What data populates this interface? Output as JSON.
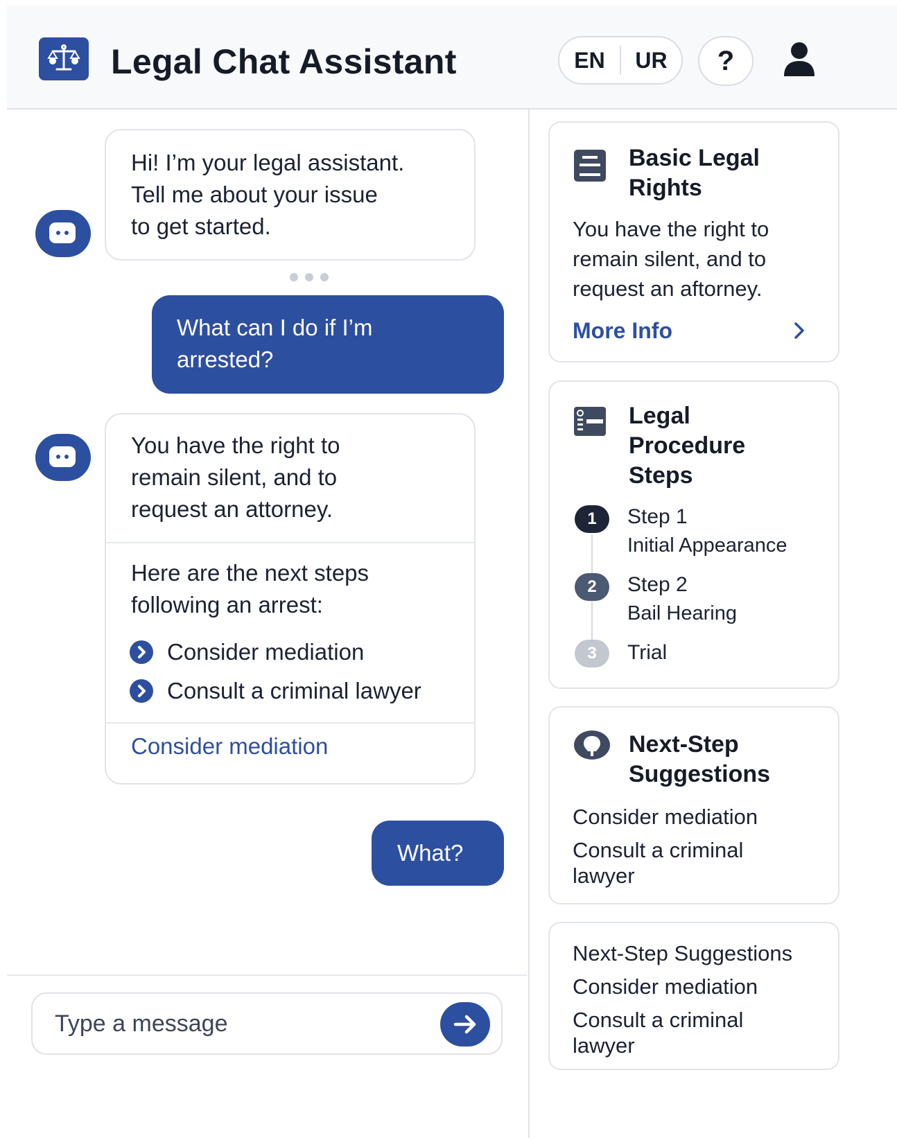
{
  "header": {
    "title": "Legal Chat Assistant",
    "lang_en": "EN",
    "lang_ur": "UR",
    "help": "?"
  },
  "chat": {
    "messages": [
      {
        "from": "bot",
        "text": [
          "Hi! I’m your legal assistant.",
          "Tell me about your issue",
          "to get started."
        ]
      },
      {
        "from": "user",
        "text": [
          "What can I do if I’m",
          "arrested?"
        ]
      },
      {
        "from": "bot",
        "text": [
          "You have the right to",
          "remain silent, and to",
          "request an attorney."
        ],
        "steps_intro": [
          "Here are the next steps",
          "following an arrest:"
        ],
        "steps": [
          "Consider mediation",
          "Consult a criminal lawyer"
        ],
        "action": "Consider mediation"
      },
      {
        "from": "user",
        "text": [
          "What?"
        ]
      }
    ],
    "input_placeholder": "Type a message"
  },
  "sidebar": {
    "rights": {
      "title": [
        "Basic Legal",
        "Rights"
      ],
      "text": [
        "You have the right to",
        "remain silent, and to",
        "request an aftorney."
      ],
      "link": "More Info"
    },
    "procedure": {
      "title": [
        "Legal",
        "Procedure",
        "Steps"
      ],
      "steps": [
        {
          "num": "1",
          "title": "Step 1",
          "sub": "Initial Appearance"
        },
        {
          "num": "2",
          "title": "Step 2",
          "sub": "Bail Hearing"
        },
        {
          "num": "3",
          "title": "Trial",
          "sub": ""
        }
      ]
    },
    "suggestions": {
      "title": [
        "Next-Step",
        "Suggestions"
      ],
      "items": [
        "Consider mediation",
        "Consult a criminal",
        "lawyer"
      ]
    },
    "suggestions2": {
      "items": [
        "Next-Step Suggestions",
        "Consider mediation",
        "Consult a criminal",
        "lawyer"
      ]
    }
  },
  "colors": {
    "accent": "#2d4fa0",
    "step1": "#1d2536",
    "step2": "#4b5a73",
    "step3": "#c3c7cf"
  }
}
